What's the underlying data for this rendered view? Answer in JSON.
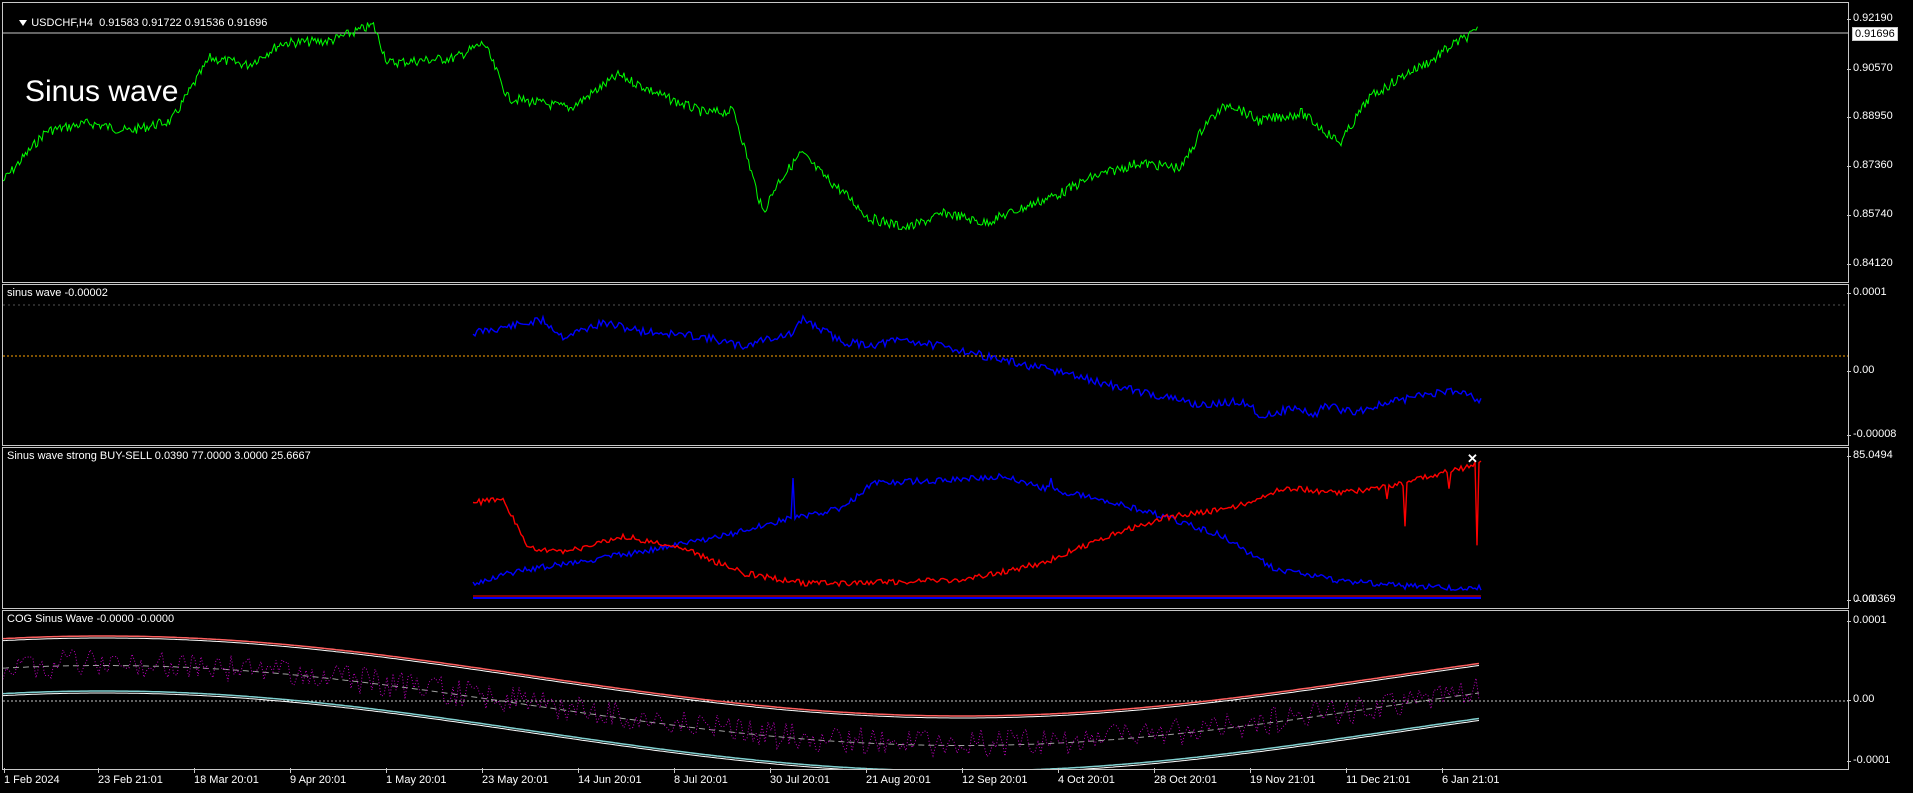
{
  "main": {
    "symbol_label": "USDCHF,H4",
    "ohlc_label": "0.91583 0.91722 0.91536 0.91696",
    "title": "Sinus wave",
    "price_ticks": [
      "0.92190",
      "0.90570",
      "0.88950",
      "0.87360",
      "0.85740",
      "0.84120"
    ],
    "current_price_tag": "0.91696",
    "line_color": "#00ff00"
  },
  "pane2": {
    "label": "sinus wave -0.00002",
    "ticks": [
      "0.0001",
      "0.00",
      "-0.00008"
    ],
    "line_color": "#0000ff",
    "level_color": "#ffa500"
  },
  "pane3": {
    "label": "Sinus wave strong BUY-SELL 0.0390 77.0000 3.0000 25.6667",
    "ticks": [
      "85.0494",
      "0.0369"
    ],
    "tick_overlap": "0.00",
    "buy_color": "#0000ff",
    "sell_color": "#ff0000",
    "marker_icon": "x-cross-icon"
  },
  "pane4": {
    "label": "COG Sinus Wave -0.0000 -0.0000",
    "ticks": [
      "0.0001",
      "0.00",
      "-0.0001"
    ],
    "upper_band_color": "#ff6060",
    "lower_band_color": "#80d0d0",
    "dots_color": "#c000c0"
  },
  "time_axis": [
    "1 Feb 2024",
    "23 Feb 21:01",
    "18 Mar 20:01",
    "9 Apr 20:01",
    "1 May 20:01",
    "23 May 20:01",
    "14 Jun 20:01",
    "8 Jul 20:01",
    "30 Jul 20:01",
    "21 Aug 20:01",
    "12 Sep 20:01",
    "4 Oct 20:01",
    "28 Oct 20:01",
    "19 Nov 21:01",
    "11 Dec 21:01",
    "6 Jan 21:01"
  ]
}
